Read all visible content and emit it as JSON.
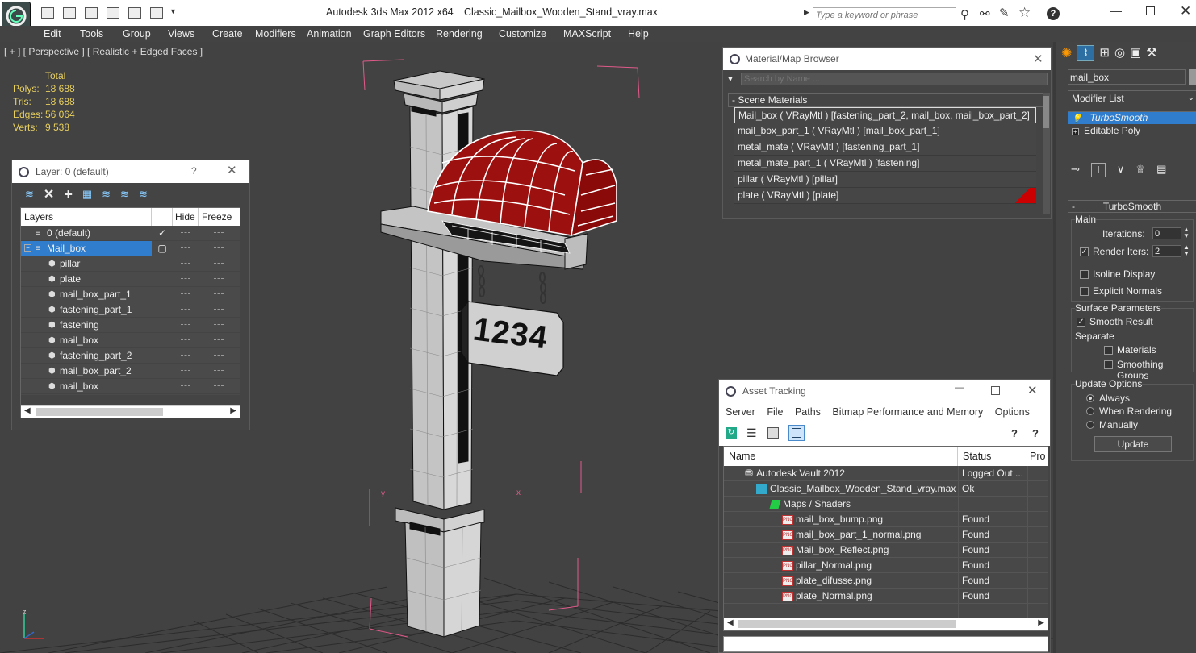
{
  "app": {
    "title": "Autodesk 3ds Max  2012 x64",
    "file": "Classic_Mailbox_Wooden_Stand_vray.max",
    "search_placeholder": "Type a keyword or phrase"
  },
  "menu": [
    "Edit",
    "Tools",
    "Group",
    "Views",
    "Create",
    "Modifiers",
    "Animation",
    "Graph Editors",
    "Rendering",
    "Customize",
    "MAXScript",
    "Help"
  ],
  "viewport": {
    "label": "[ + ] [ Perspective ] [ Realistic + Edged Faces ]",
    "stats": {
      "header": "Total",
      "rows": [
        {
          "label": "Polys:",
          "value": "18 688"
        },
        {
          "label": "Tris:",
          "value": "18 688"
        },
        {
          "label": "Edges:",
          "value": "56 064"
        },
        {
          "label": "Verts:",
          "value": "9 538"
        }
      ]
    },
    "sign_number": "1234",
    "axis_z": "z",
    "axis_x": "x",
    "axis_y": "y"
  },
  "layers": {
    "title": "Layer: 0 (default)",
    "help": "?",
    "columns": [
      "Layers",
      "Hide",
      "Freeze"
    ],
    "rows": [
      {
        "name": "0 (default)",
        "indent": 1,
        "checked": true,
        "selected": false
      },
      {
        "name": "Mail_box",
        "indent": 1,
        "checked": false,
        "selected": true
      },
      {
        "name": "pillar",
        "indent": 2
      },
      {
        "name": "plate",
        "indent": 2
      },
      {
        "name": "mail_box_part_1",
        "indent": 2
      },
      {
        "name": "fastening_part_1",
        "indent": 2
      },
      {
        "name": "fastening",
        "indent": 2
      },
      {
        "name": "mail_box",
        "indent": 2
      },
      {
        "name": "fastening_part_2",
        "indent": 2
      },
      {
        "name": "mail_box_part_2",
        "indent": 2
      },
      {
        "name": "mail_box",
        "indent": 2
      }
    ]
  },
  "matbrowser": {
    "title": "Material/Map Browser",
    "search_placeholder": "Search by Name ...",
    "section": "- Scene Materials",
    "items": [
      "Mail_box  ( VRayMtl ) [fastening_part_2, mail_box, mail_box_part_2]",
      "mail_box_part_1  ( VRayMtl ) [mail_box_part_1]",
      "metal_mate  ( VRayMtl ) [fastening_part_1]",
      "metal_mate_part_1  ( VRayMtl ) [fastening]",
      "pillar  ( VRayMtl ) [pillar]",
      "plate  ( VRayMtl ) [plate]"
    ]
  },
  "asset": {
    "title": "Asset Tracking",
    "menu": [
      "Server",
      "File",
      "Paths",
      "Bitmap Performance and Memory",
      "Options"
    ],
    "columns": [
      "Name",
      "Status",
      "Pro"
    ],
    "rows": [
      {
        "name": "Autodesk Vault 2012",
        "status": "Logged Out ...",
        "indent": 26,
        "icon": "vault"
      },
      {
        "name": "Classic_Mailbox_Wooden_Stand_vray.max",
        "status": "Ok",
        "indent": 40,
        "icon": "max"
      },
      {
        "name": "Maps / Shaders",
        "status": "",
        "indent": 58,
        "icon": "maps"
      },
      {
        "name": "mail_box_bump.png",
        "status": "Found",
        "indent": 72,
        "icon": "png"
      },
      {
        "name": "mail_box_part_1_normal.png",
        "status": "Found",
        "indent": 72,
        "icon": "png"
      },
      {
        "name": "Mail_box_Reflect.png",
        "status": "Found",
        "indent": 72,
        "icon": "png"
      },
      {
        "name": "pillar_Normal.png",
        "status": "Found",
        "indent": 72,
        "icon": "png"
      },
      {
        "name": "plate_difusse.png",
        "status": "Found",
        "indent": 72,
        "icon": "png"
      },
      {
        "name": "plate_Normal.png",
        "status": "Found",
        "indent": 72,
        "icon": "png"
      }
    ]
  },
  "cmd": {
    "object_name": "mail_box",
    "modifier_list": "Modifier List",
    "stack": [
      "TurboSmooth",
      "Editable Poly"
    ],
    "rollout_title": "TurboSmooth",
    "main_group": "Main",
    "iterations_label": "Iterations:",
    "iterations_value": "0",
    "render_iters_label": "Render Iters:",
    "render_iters_value": "2",
    "isoline": "Isoline Display",
    "explicit": "Explicit Normals",
    "surface_group": "Surface Parameters",
    "smooth_result": "Smooth Result",
    "separate": "Separate",
    "materials": "Materials",
    "smoothing_groups": "Smoothing Groups",
    "update_group": "Update Options",
    "always": "Always",
    "when_rendering": "When Rendering",
    "manually": "Manually",
    "update_btn": "Update"
  }
}
